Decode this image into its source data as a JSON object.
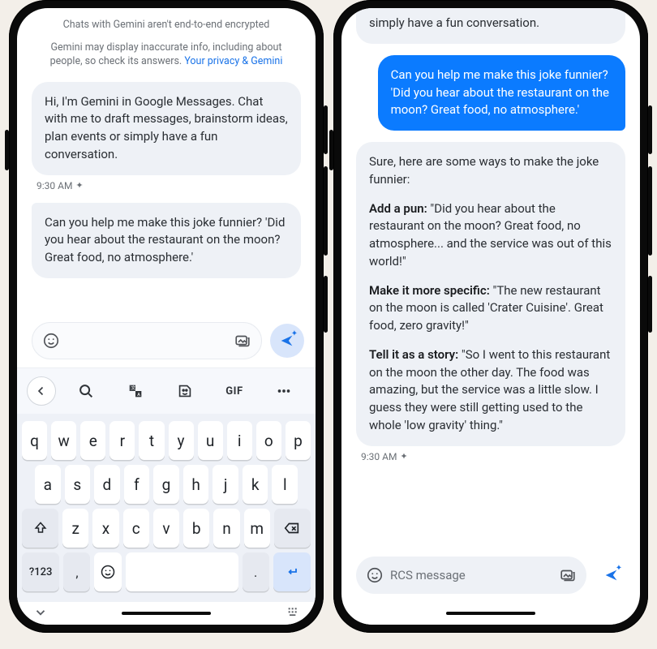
{
  "left": {
    "notice_encryption": "Chats with Gemini aren't end-to-end encrypted",
    "notice_accuracy": "Gemini may display inaccurate info, including about people, so check its answers. ",
    "notice_link": "Your privacy & Gemini",
    "greeting": "Hi, I'm Gemini in Google Messages. Chat with me to draft messages, brainstorm ideas, plan events or simply have a fun conversation.",
    "time": "9:30 AM",
    "draft": "Can you help me make this joke funnier? 'Did you hear about the restaurant on the moon? Great food, no atmosphere.'",
    "sugstrip": {
      "gif_label": "GIF"
    },
    "keyboard": {
      "rows": [
        [
          "q",
          "w",
          "e",
          "r",
          "t",
          "y",
          "u",
          "i",
          "o",
          "p"
        ],
        [
          "a",
          "s",
          "d",
          "f",
          "g",
          "h",
          "j",
          "k",
          "l"
        ],
        [
          "⇧",
          "z",
          "x",
          "c",
          "v",
          "b",
          "n",
          "m",
          "⌫"
        ]
      ],
      "numtoggle": "?123",
      "comma": ",",
      "period": "."
    }
  },
  "right": {
    "intro_tail": "simply have a fun conversation.",
    "user_msg": "Can you help me make this joke funnier? 'Did you hear about the restaurant on the moon? Great food, no atmosphere.'",
    "reply": {
      "lead": "Sure, here are some ways to make the joke funnier:",
      "tips": [
        {
          "title": "Add a pun:",
          "body": " \"Did you hear about the restaurant on the moon? Great food, no atmosphere... and the service was out of this world!\""
        },
        {
          "title": "Make it more specific:",
          "body": " \"The new restaurant on the moon is called 'Crater Cuisine'. Great food, zero gravity!\""
        },
        {
          "title": "Tell it as a story:",
          "body": " \"So I went to this restaurant on the moon the other day. The food was amazing, but the service was a little slow. I guess they were still getting used to the whole 'low gravity' thing.\""
        }
      ]
    },
    "time": "9:30 AM",
    "placeholder": "RCS message"
  }
}
